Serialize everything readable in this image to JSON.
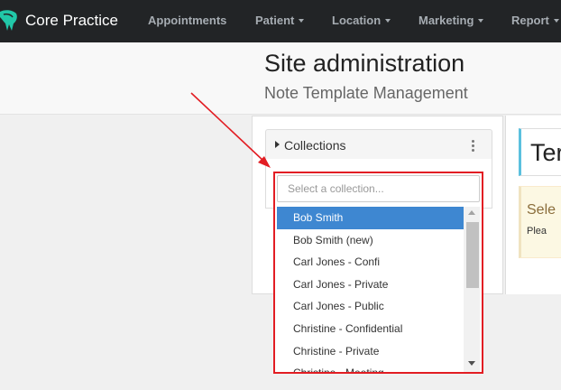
{
  "nav": {
    "brand": "Core Practice",
    "items": [
      {
        "label": "Appointments",
        "caret": false
      },
      {
        "label": "Patient",
        "caret": true
      },
      {
        "label": "Location",
        "caret": true
      },
      {
        "label": "Marketing",
        "caret": true
      },
      {
        "label": "Report",
        "caret": true
      }
    ]
  },
  "header": {
    "title": "Site administration",
    "subtitle": "Note Template Management"
  },
  "collections": {
    "label": "Collections",
    "placeholder": "Select a collection...",
    "options": [
      "Bob Smith",
      "Bob Smith (new)",
      "Carl Jones - Confi",
      "Carl Jones - Private",
      "Carl Jones - Public",
      "Christine - Confidential",
      "Christine - Private",
      "Christine - Meeting"
    ],
    "selected_index": 0
  },
  "right_panel": {
    "title": "Ter",
    "warning_title": "Sele",
    "warning_text": "Plea"
  },
  "colors": {
    "nav_bg": "#222426",
    "accent_teal": "#21c7a8",
    "selected_bg": "#3e87d1",
    "annotation_red": "#e21d23"
  }
}
